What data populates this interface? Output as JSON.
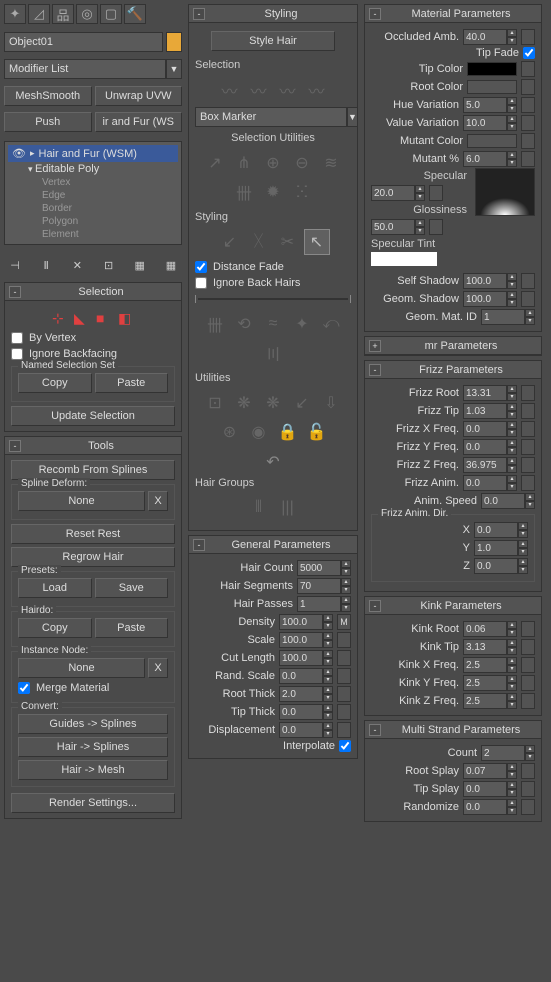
{
  "left": {
    "object_name": "Object01",
    "modifier_list": "Modifier List",
    "buttons": {
      "meshsmooth": "MeshSmooth",
      "unwrap": "Unwrap UVW",
      "push": "Push",
      "ir_fur": "ir and Fur (WS"
    },
    "tree": {
      "main": "Hair and Fur (WSM)",
      "sub": "Editable Poly",
      "items": [
        "Vertex",
        "Edge",
        "Border",
        "Polygon",
        "Element"
      ]
    },
    "selection": {
      "title": "Selection",
      "by_vertex": "By Vertex",
      "ignore_backfacing": "Ignore Backfacing",
      "named_set": "Named Selection Set",
      "copy": "Copy",
      "paste": "Paste",
      "update": "Update Selection"
    },
    "tools": {
      "title": "Tools",
      "recomb": "Recomb From Splines",
      "spline_deform": "Spline Deform:",
      "none": "None",
      "reset_rest": "Reset Rest",
      "regrow": "Regrow Hair",
      "presets": "Presets:",
      "load": "Load",
      "save": "Save",
      "hairdo": "Hairdo:",
      "copy": "Copy",
      "paste": "Paste",
      "instance_node": "Instance Node:",
      "merge": "Merge Material",
      "convert": "Convert:",
      "guides_splines": "Guides -> Splines",
      "hair_splines": "Hair -> Splines",
      "hair_mesh": "Hair -> Mesh",
      "render_settings": "Render Settings..."
    }
  },
  "mid": {
    "styling": {
      "title": "Styling",
      "style_hair": "Style Hair",
      "selection": "Selection",
      "box_marker": "Box Marker",
      "sel_utils": "Selection Utilities",
      "styling_lbl": "Styling",
      "distance_fade": "Distance Fade",
      "ignore_back": "Ignore Back Hairs",
      "utilities": "Utilities",
      "hair_groups": "Hair Groups"
    },
    "general": {
      "title": "General Parameters",
      "hair_count": "Hair Count",
      "hair_count_v": "5000",
      "hair_segments": "Hair Segments",
      "hair_segments_v": "70",
      "hair_passes": "Hair Passes",
      "hair_passes_v": "1",
      "density": "Density",
      "density_v": "100.0",
      "scale": "Scale",
      "scale_v": "100.0",
      "cut_length": "Cut Length",
      "cut_length_v": "100.0",
      "rand_scale": "Rand. Scale",
      "rand_scale_v": "0.0",
      "root_thick": "Root Thick",
      "root_thick_v": "2.0",
      "tip_thick": "Tip Thick",
      "tip_thick_v": "0.0",
      "displacement": "Displacement",
      "displacement_v": "0.0",
      "interpolate": "Interpolate"
    }
  },
  "right": {
    "material": {
      "title": "Material Parameters",
      "occluded_amb": "Occluded Amb.",
      "occluded_amb_v": "40.0",
      "tip_fade": "Tip Fade",
      "tip_color": "Tip Color",
      "root_color": "Root Color",
      "hue_var": "Hue Variation",
      "hue_var_v": "5.0",
      "value_var": "Value Variation",
      "value_var_v": "10.0",
      "mutant_color": "Mutant Color",
      "mutant_pct": "Mutant %",
      "mutant_pct_v": "6.0",
      "specular": "Specular",
      "specular_v": "20.0",
      "glossiness": "Glossiness",
      "glossiness_v": "50.0",
      "specular_tint": "Specular Tint",
      "self_shadow": "Self Shadow",
      "self_shadow_v": "100.0",
      "geom_shadow": "Geom. Shadow",
      "geom_shadow_v": "100.0",
      "geom_mat_id": "Geom. Mat. ID",
      "geom_mat_id_v": "1"
    },
    "mr": {
      "title": "mr Parameters"
    },
    "frizz": {
      "title": "Frizz Parameters",
      "root": "Frizz Root",
      "root_v": "13.31",
      "tip": "Frizz Tip",
      "tip_v": "1.03",
      "x": "Frizz X Freq.",
      "x_v": "0.0",
      "y": "Frizz Y Freq.",
      "y_v": "0.0",
      "z": "Frizz Z Freq.",
      "z_v": "36.975",
      "anim": "Frizz Anim.",
      "anim_v": "0.0",
      "speed": "Anim. Speed",
      "speed_v": "0.0",
      "anim_dir": "Frizz Anim. Dir.",
      "dir_x": "X",
      "dir_x_v": "0.0",
      "dir_y": "Y",
      "dir_y_v": "1.0",
      "dir_z": "Z",
      "dir_z_v": "0.0"
    },
    "kink": {
      "title": "Kink Parameters",
      "root": "Kink Root",
      "root_v": "0.06",
      "tip": "Kink Tip",
      "tip_v": "3.13",
      "x": "Kink X Freq.",
      "x_v": "2.5",
      "y": "Kink Y Freq.",
      "y_v": "2.5",
      "z": "Kink Z Freq.",
      "z_v": "2.5"
    },
    "multi": {
      "title": "Multi Strand Parameters",
      "count": "Count",
      "count_v": "2",
      "root_splay": "Root Splay",
      "root_splay_v": "0.07",
      "tip_splay": "Tip Splay",
      "tip_splay_v": "0.0",
      "randomize": "Randomize",
      "randomize_v": "0.0"
    }
  }
}
